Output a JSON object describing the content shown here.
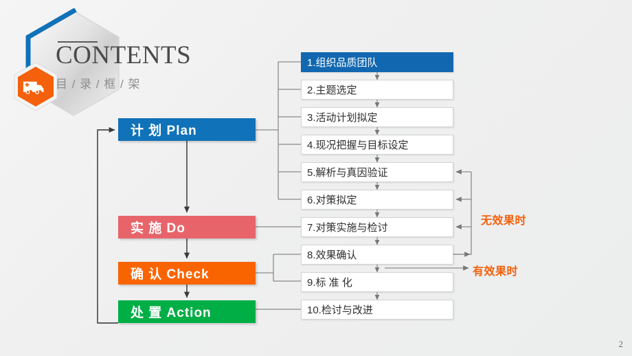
{
  "slide": {
    "page_number": "2",
    "background_color": "#efefef"
  },
  "header": {
    "title": "CONTENTS",
    "subtitle": "目 / 录 / 框 / 架",
    "logo_icon": "ambulance-icon",
    "hex_accent_color": "#1072B8",
    "badge_color": "#F4600B"
  },
  "pdca": {
    "stages": [
      {
        "label": "计  划 Plan",
        "color": "#1072B8",
        "key": "plan"
      },
      {
        "label": "实  施 Do",
        "color": "#E8646B",
        "key": "do"
      },
      {
        "label": "确  认 Check",
        "color": "#FA6400",
        "key": "check"
      },
      {
        "label": "处  置 Action",
        "color": "#00AE46",
        "key": "action"
      }
    ]
  },
  "steps": [
    {
      "label": "1.组织品质团队",
      "active": true
    },
    {
      "label": "2.主题选定",
      "active": false
    },
    {
      "label": "3.活动计划拟定",
      "active": false
    },
    {
      "label": "4.现况把握与目标设定",
      "active": false
    },
    {
      "label": "5.解析与真因验证",
      "active": false
    },
    {
      "label": "6.对策拟定",
      "active": false
    },
    {
      "label": "7.对策实施与检讨",
      "active": false
    },
    {
      "label": "8.效果确认",
      "active": false
    },
    {
      "label": "9.标 准 化",
      "active": false
    },
    {
      "label": "10.检讨与改进",
      "active": false
    }
  ],
  "loop_labels": {
    "invalid": "无效果时",
    "valid": "有效果时",
    "color": "#F4600B"
  }
}
